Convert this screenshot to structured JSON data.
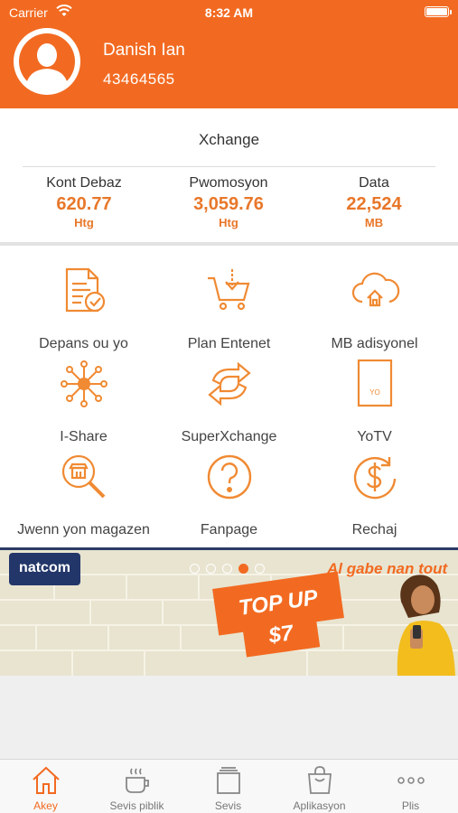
{
  "status_bar": {
    "carrier": "Carrier",
    "time": "8:32 AM"
  },
  "profile": {
    "name": "Danish Ian",
    "number": "43464565"
  },
  "balance": {
    "title": "Xchange",
    "columns": [
      {
        "label": "Kont Debaz",
        "value": "620.77",
        "unit": "Htg"
      },
      {
        "label": "Pwomosyon",
        "value": "3,059.76",
        "unit": "Htg"
      },
      {
        "label": "Data",
        "value": "22,524",
        "unit": "MB"
      }
    ]
  },
  "services": [
    {
      "label": "Depans ou yo",
      "icon": "expenses-document-icon"
    },
    {
      "label": "Plan Entenet",
      "icon": "internet-cart-icon"
    },
    {
      "label": "MB adisyonel",
      "icon": "cloud-data-icon"
    },
    {
      "label": "I-Share",
      "icon": "share-network-icon"
    },
    {
      "label": "SuperXchange",
      "icon": "exchange-arrows-icon"
    },
    {
      "label": "YoTV",
      "icon": "tv-device-icon"
    },
    {
      "label": "Jwenn yon magazen",
      "icon": "store-search-icon"
    },
    {
      "label": "Fanpage",
      "icon": "question-circle-icon"
    },
    {
      "label": "Rechaj",
      "icon": "recharge-dollar-icon"
    }
  ],
  "banner": {
    "logo": "natcom",
    "tagline": "Al gabe nan tout",
    "headline": "TOP UP",
    "amount": "$7",
    "slides_total": 5,
    "active_slide": 4
  },
  "tabbar": {
    "active": 0,
    "items": [
      {
        "label": "Akey",
        "icon": "home-icon"
      },
      {
        "label": "Sevis piblik",
        "icon": "coffee-cup-icon"
      },
      {
        "label": "Sevis",
        "icon": "services-stack-icon"
      },
      {
        "label": "Aplikasyon",
        "icon": "shopping-bag-icon"
      },
      {
        "label": "Plis",
        "icon": "more-dots-icon"
      }
    ]
  },
  "colors": {
    "brand": "#f26a21",
    "value": "#e8772a",
    "banner_navy": "#23366a"
  }
}
